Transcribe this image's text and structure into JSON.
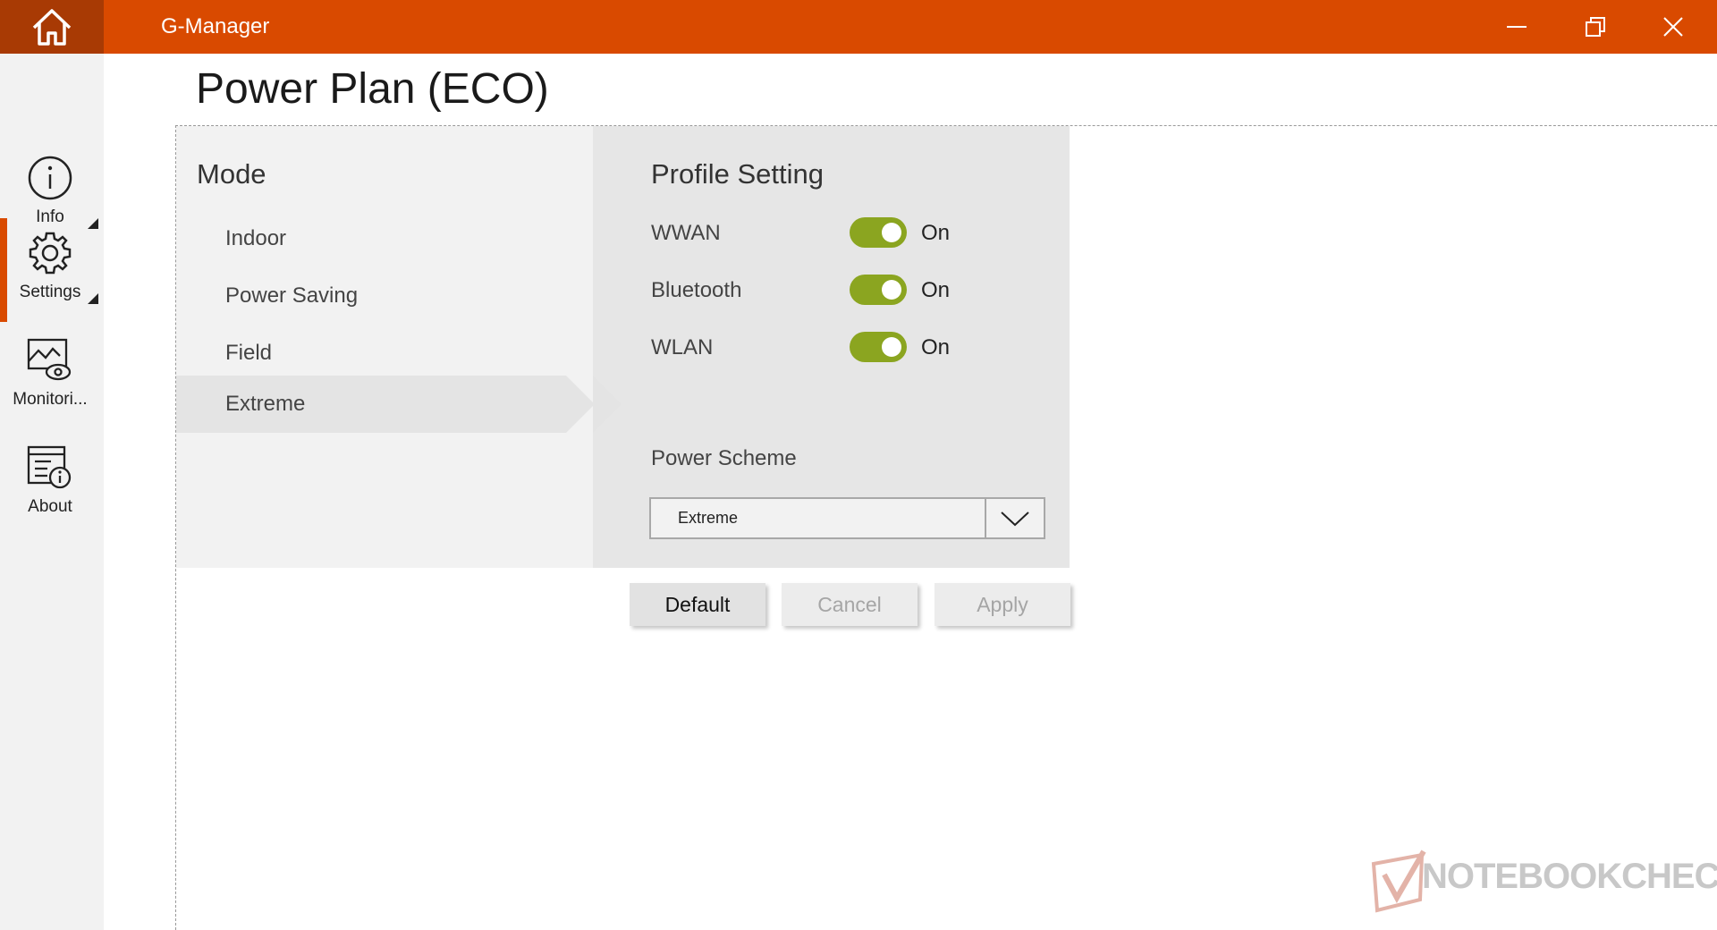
{
  "window": {
    "title": "G-Manager",
    "accent_color": "#d94a00"
  },
  "nav": {
    "items": [
      {
        "label": "Info",
        "icon": "info-icon"
      },
      {
        "label": "Settings",
        "icon": "gear-icon",
        "active": true
      },
      {
        "label": "Monitori...",
        "icon": "monitoring-icon"
      },
      {
        "label": "About",
        "icon": "about-icon"
      }
    ]
  },
  "page": {
    "title": "Power Plan (ECO)"
  },
  "mode": {
    "heading": "Mode",
    "items": [
      "Indoor",
      "Power Saving",
      "Field",
      "Extreme"
    ],
    "selected": "Extreme"
  },
  "profile": {
    "heading": "Profile Setting",
    "toggles": [
      {
        "label": "WWAN",
        "state": "On"
      },
      {
        "label": "Bluetooth",
        "state": "On"
      },
      {
        "label": "WLAN",
        "state": "On"
      }
    ],
    "toggle_color": "#8ba520",
    "scheme_label": "Power Scheme",
    "scheme_value": "Extreme"
  },
  "buttons": {
    "default": "Default",
    "cancel": "Cancel",
    "apply": "Apply"
  },
  "watermark": {
    "text": "NOTEBOOKCHECK"
  }
}
